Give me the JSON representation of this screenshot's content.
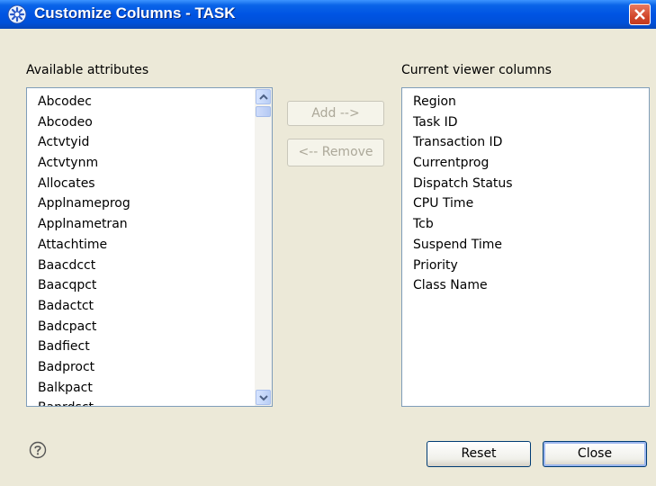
{
  "window": {
    "title": "Customize Columns - TASK"
  },
  "available": {
    "label": "Available attributes",
    "items": [
      "Abcodec",
      "Abcodeo",
      "Actvtyid",
      "Actvtynm",
      "Allocates",
      "Applnameprog",
      "Applnametran",
      "Attachtime",
      "Baacdcct",
      "Baacqpct",
      "Badactct",
      "Badcpact",
      "Badfiect",
      "Badproct",
      "Balkpact",
      "Banrdsct"
    ]
  },
  "buttons": {
    "add": "Add -->",
    "remove": "<-- Remove",
    "reset": "Reset",
    "close": "Close"
  },
  "current": {
    "label": "Current viewer columns",
    "items": [
      "Region",
      "Task ID",
      "Transaction ID",
      "Currentprog",
      "Dispatch Status",
      "CPU Time",
      "Tcb",
      "Suspend Time",
      "Priority",
      "Class Name"
    ]
  },
  "icons": {
    "app": "gear-icon",
    "help": "help-icon",
    "close": "close-icon"
  },
  "colors": {
    "titlebar": "#0054e3",
    "dialog_bg": "#ece9d8",
    "list_border": "#7f9db9"
  }
}
